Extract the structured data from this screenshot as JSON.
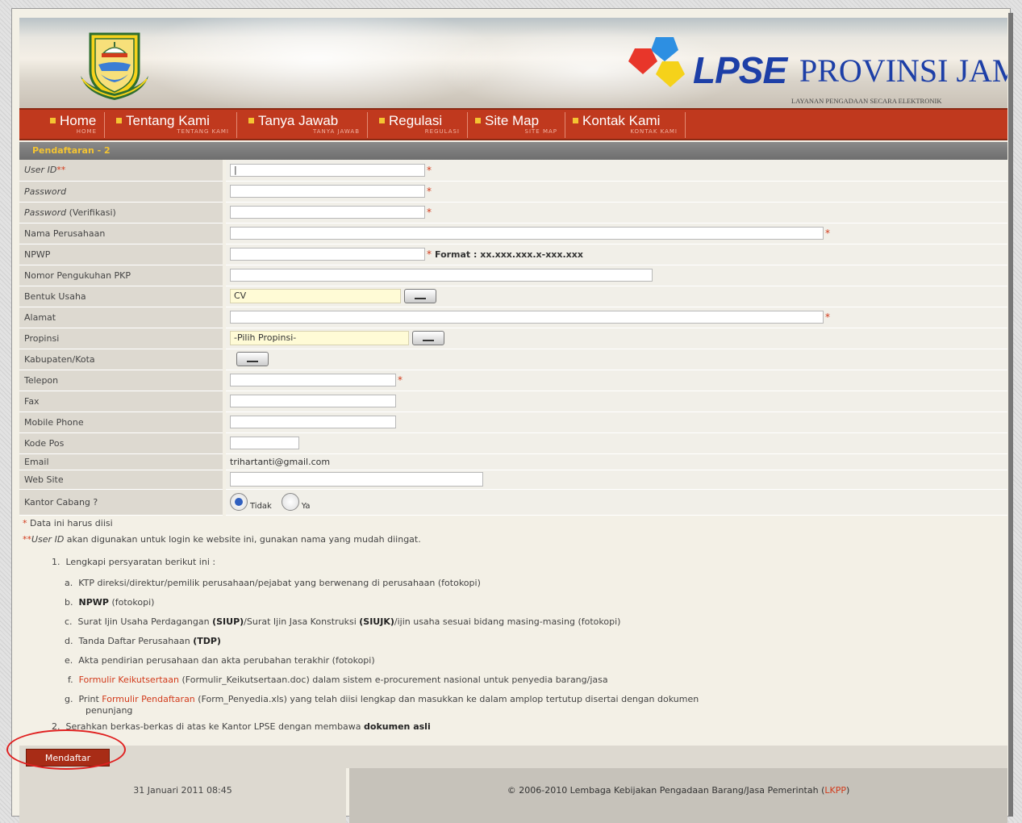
{
  "brand": {
    "lpse": "LPSE",
    "province": "PROVINSI JAMBI",
    "tagline": "LAYANAN PENGADAAN SECARA ELEKTRONIK"
  },
  "nav": [
    {
      "label": "Home",
      "sub": "HOME"
    },
    {
      "label": "Tentang Kami",
      "sub": "TENTANG KAMI"
    },
    {
      "label": "Tanya Jawab",
      "sub": "TANYA JAWAB"
    },
    {
      "label": "Regulasi",
      "sub": "REGULASI"
    },
    {
      "label": "Site Map",
      "sub": "SITE MAP"
    },
    {
      "label": "Kontak Kami",
      "sub": "KONTAK KAMI"
    }
  ],
  "section_title": "Pendaftaran - 2",
  "form": {
    "user_id_label": "User ID",
    "user_id_marker": "**",
    "password_label": "Password",
    "password_verif_label": "Password",
    "password_verif_suffix": "(Verifikasi)",
    "nama_label": "Nama Perusahaan",
    "npwp_label": "NPWP",
    "npwp_format": "Format : xx.xxx.xxx.x-xxx.xxx",
    "pkp_label": "Nomor Pengukuhan PKP",
    "bentuk_label": "Bentuk Usaha",
    "bentuk_value": "CV",
    "alamat_label": "Alamat",
    "propinsi_label": "Propinsi",
    "propinsi_value": "-Pilih Propinsi-",
    "kabupaten_label": "Kabupaten/Kota",
    "telepon_label": "Telepon",
    "fax_label": "Fax",
    "mobile_label": "Mobile Phone",
    "kodepos_label": "Kode Pos",
    "email_label": "Email",
    "email_value": "trihartanti@gmail.com",
    "website_label": "Web Site",
    "cabang_label": "Kantor Cabang ?",
    "radio_tidak": "Tidak",
    "radio_ya": "Ya",
    "required_star": "*"
  },
  "notes": {
    "star": "*",
    "n1": "Data ini harus diisi",
    "dstar": "**",
    "n2_italic": "User ID",
    "n2_rest": "akan digunakan untuk login ke website ini, gunakan nama yang mudah diingat."
  },
  "steps": {
    "s1_num": "1.",
    "s1": "Lengkapi persyaratan berikut ini :",
    "a_key": "a.",
    "a": "KTP direksi/direktur/pemilik perusahaan/pejabat yang berwenang di perusahaan (fotokopi)",
    "b_key": "b.",
    "b_bold": "NPWP",
    "b_rest": "(fotokopi)",
    "c_key": "c.",
    "c_1": "Surat Ijin Usaha Perdagangan",
    "c_b1": "(SIUP)",
    "c_2": "/Surat Ijin Jasa Konstruksi",
    "c_b2": "(SIUJK)",
    "c_3": "/ijin usaha sesuai bidang masing-masing (fotokopi)",
    "d_key": "d.",
    "d_1": "Tanda Daftar Perusahaan",
    "d_b": "(TDP)",
    "e_key": "e.",
    "e": "Akta pendirian perusahaan dan akta perubahan terakhir (fotokopi)",
    "f_key": "f.",
    "f_link": "Formulir Keikutsertaan",
    "f_rest": "(Formulir_Keikutsertaan.doc) dalam sistem e-procurement nasional untuk penyedia barang/jasa",
    "g_key": "g.",
    "g_1": "Print",
    "g_link": "Formulir Pendaftaran",
    "g_rest": "(Form_Penyedia.xls) yang telah diisi lengkap dan masukkan ke dalam amplop tertutup disertai dengan dokumen",
    "g_cont": "penunjang",
    "s2_num": "2.",
    "s2": "Serahkan berkas-berkas di atas ke Kantor LPSE dengan membawa",
    "s2_bold": "dokumen asli"
  },
  "submit_label": "Mendaftar",
  "footer": {
    "datetime": "31 Januari 2011 08:45",
    "copyright": "© 2006-2010 Lembaga Kebijakan Pengadaan Barang/Jasa Pemerintah (",
    "lkpp": "LKPP",
    "close": ")"
  },
  "colors": {
    "nav_bg": "#c0391e",
    "accent_yellow": "#f4c432",
    "required_red": "#d23b1c",
    "brand_blue": "#1d3fa7"
  }
}
